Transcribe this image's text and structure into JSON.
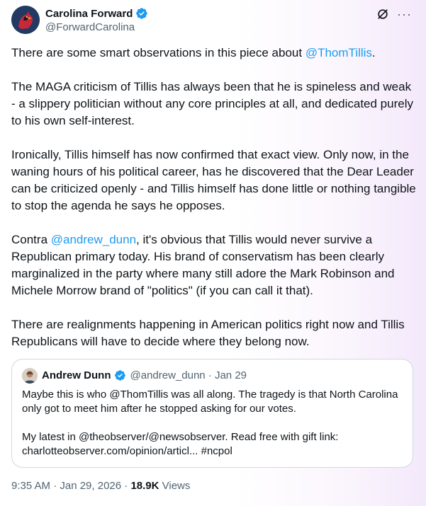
{
  "author": {
    "name": "Carolina Forward",
    "handle": "@ForwardCarolina",
    "avatar_icon": "cardinal-bird-avatar-icon",
    "verified_icon": "verified-badge-icon",
    "verified_color": "#1d9bf0"
  },
  "top_actions": {
    "grok_icon": "grok-icon",
    "more_label": "···"
  },
  "post": {
    "p1": {
      "before": "There are some smart observations in this piece about ",
      "mention": "@ThomTillis",
      "after": "."
    },
    "p2": "The MAGA criticism of Tillis has always been that he is spineless and weak - a slippery politician without any core principles at all, and dedicated purely to his own self-interest.",
    "p3": "Ironically, Tillis himself has now confirmed that exact view. Only now, in the waning hours of his political career, has he discovered that the Dear Leader can be criticized openly - and Tillis himself has done little or nothing tangible to stop the agenda he says he opposes.",
    "p4": {
      "before": "Contra ",
      "mention": "@andrew_dunn",
      "after": ", it's obvious that Tillis would never survive a Republican primary today. His brand of conservatism has been clearly marginalized in the party where many still adore the Mark Robinson and Michele Morrow brand of \"politics\" (if you can call it that)."
    },
    "p5": "There are realignments happening in American politics right now and Tillis Republicans will have to decide where they belong now."
  },
  "quote": {
    "name": "Andrew Dunn",
    "meta": "@andrew_dunn · Jan 29",
    "avatar_icon": "person-avatar-icon",
    "p1": "Maybe this is who @ThomTillis was all along. The tragedy is that North Carolina only got to meet him after he stopped asking for our votes.",
    "p2": "My latest in @theobserver/@newsobserver. Read free with gift link: charlotteobserver.com/opinion/articl... #ncpol"
  },
  "footer": {
    "time": "9:35 AM · Jan 29, 2026 · ",
    "views_count": "18.9K",
    "views_label": " Views"
  },
  "colors": {
    "link": "#1d9bf0",
    "text": "#0f1419",
    "secondary": "#536471",
    "border": "#cfd9de"
  }
}
